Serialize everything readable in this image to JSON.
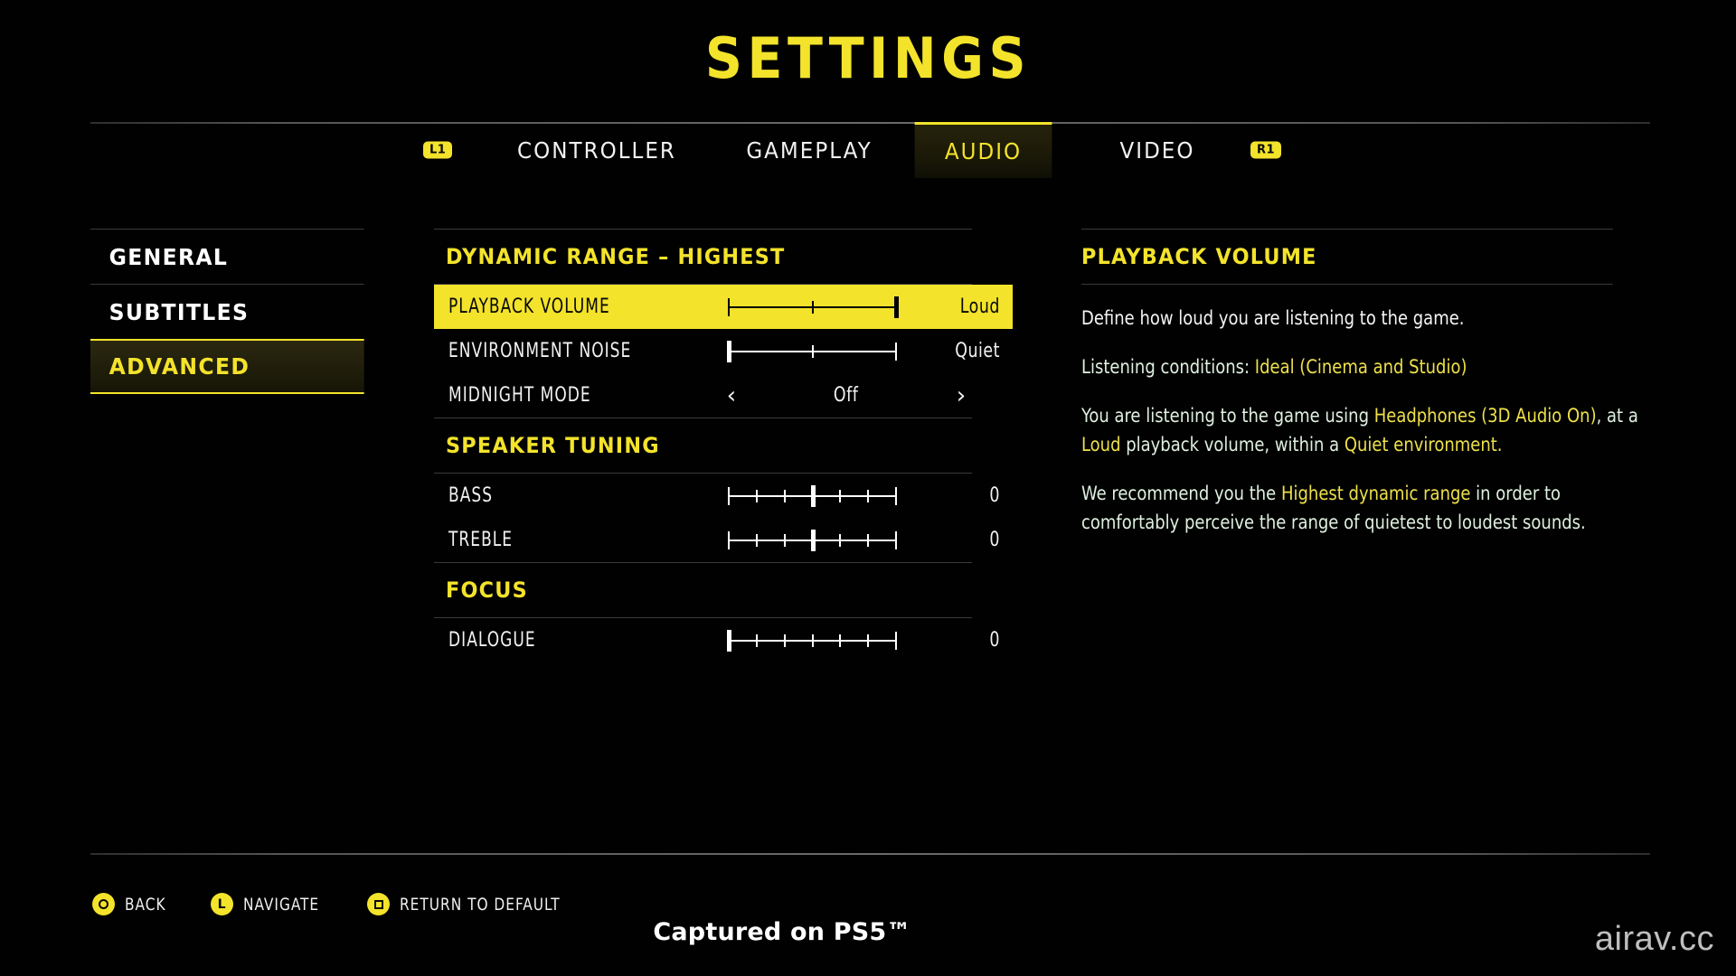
{
  "page": {
    "title": "SETTINGS"
  },
  "tabbar": {
    "left_shoulder": "L1",
    "right_shoulder": "R1",
    "tabs": [
      {
        "label": "CONTROLLER",
        "active": false
      },
      {
        "label": "GAMEPLAY",
        "active": false
      },
      {
        "label": "AUDIO",
        "active": true
      },
      {
        "label": "VIDEO",
        "active": false
      }
    ]
  },
  "categories": [
    {
      "label": "GENERAL",
      "selected": false
    },
    {
      "label": "SUBTITLES",
      "selected": false
    },
    {
      "label": "ADVANCED",
      "selected": true
    }
  ],
  "sections": [
    {
      "heading": "DYNAMIC RANGE – HIGHEST",
      "rows": [
        {
          "label": "PLAYBACK VOLUME",
          "value": "Loud",
          "control": "slider",
          "steps": 3,
          "position": 2,
          "selected": true
        },
        {
          "label": "ENVIRONMENT NOISE",
          "value": "Quiet",
          "control": "slider",
          "steps": 3,
          "position": 0,
          "selected": false
        },
        {
          "label": "MIDNIGHT MODE",
          "value": "Off",
          "control": "chooser",
          "left_arrow": "‹",
          "right_arrow": "›",
          "selected": false
        }
      ]
    },
    {
      "heading": "SPEAKER TUNING",
      "rows": [
        {
          "label": "BASS",
          "value": "0",
          "control": "slider",
          "steps": 7,
          "position": 3,
          "selected": false
        },
        {
          "label": "TREBLE",
          "value": "0",
          "control": "slider",
          "steps": 7,
          "position": 3,
          "selected": false
        }
      ]
    },
    {
      "heading": "FOCUS",
      "rows": [
        {
          "label": "DIALOGUE",
          "value": "0",
          "control": "slider",
          "steps": 7,
          "position": 0,
          "selected": false
        }
      ]
    }
  ],
  "info": {
    "heading": "PLAYBACK VOLUME",
    "paragraphs": [
      {
        "style": "first",
        "parts": [
          {
            "text": "Define how loud you are listening to the game.",
            "hl": false
          }
        ]
      },
      {
        "style": "normal",
        "parts": [
          {
            "text": "Listening conditions: ",
            "hl": false
          },
          {
            "text": "Ideal (Cinema and Studio)",
            "hl": true
          }
        ]
      },
      {
        "style": "normal",
        "parts": [
          {
            "text": "You are listening to the game using ",
            "hl": false
          },
          {
            "text": "Headphones (3D Audio On)",
            "hl": true
          },
          {
            "text": ", at a ",
            "hl": false
          },
          {
            "text": "Loud",
            "hl": true
          },
          {
            "text": " playback volume, within a ",
            "hl": false
          },
          {
            "text": "Quiet environment.",
            "hl": true
          }
        ]
      },
      {
        "style": "normal",
        "parts": [
          {
            "text": "We recommend you the ",
            "hl": false
          },
          {
            "text": "Highest dynamic range",
            "hl": true
          },
          {
            "text": " in order to comfortably perceive the range of quietest to loudest sounds.",
            "hl": false
          }
        ]
      }
    ]
  },
  "footer": {
    "prompts": [
      {
        "icon": "circle-button-icon",
        "label": "BACK"
      },
      {
        "icon": "left-stick-icon",
        "label": "NAVIGATE"
      },
      {
        "icon": "square-button-icon",
        "label": "RETURN TO DEFAULT"
      }
    ],
    "captured": "Captured on PS5™",
    "watermark": "airav.cc"
  },
  "colors": {
    "accent_yellow": "#F3E32B",
    "text_white": "#F2F2F2",
    "info_text": "#DFF0E0",
    "background": "#000000"
  }
}
